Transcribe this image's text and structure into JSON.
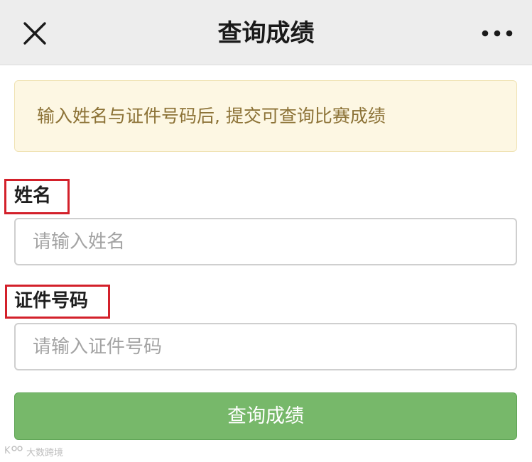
{
  "navbar": {
    "title": "查询成绩",
    "close_icon": "close-icon",
    "more_icon": "more-horizontal-icon"
  },
  "notice": {
    "text": "输入姓名与证件号码后, 提交可查询比赛成绩"
  },
  "form": {
    "name_label": "姓名",
    "name_placeholder": "请输入姓名",
    "name_value": "",
    "id_label": "证件号码",
    "id_placeholder": "请输入证件号码",
    "id_value": "",
    "submit_label": "查询成绩"
  },
  "watermark": {
    "text": "大数跨境"
  },
  "colors": {
    "navbar_bg": "#ededed",
    "notice_bg": "#fdf7e3",
    "notice_text": "#8c7236",
    "highlight_box": "#d3202a",
    "submit_bg": "#77b86a"
  }
}
